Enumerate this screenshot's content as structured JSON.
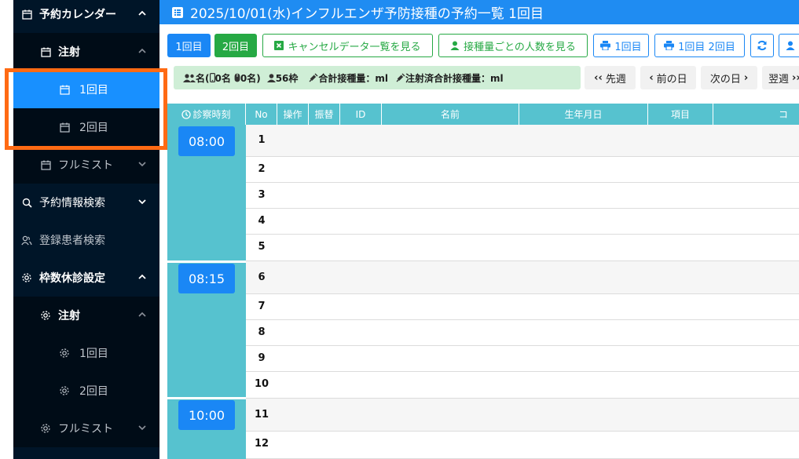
{
  "sidebar": {
    "items": [
      {
        "label": "予約カレンダー",
        "icon": "calendar-icon"
      },
      {
        "label": "注射",
        "icon": "calendar-icon"
      },
      {
        "label": "1回目",
        "icon": "calendar-icon"
      },
      {
        "label": "2回目",
        "icon": "calendar-icon"
      },
      {
        "label": "フルミスト",
        "icon": "calendar-icon"
      },
      {
        "label": "予約情報検索",
        "icon": "search-icon"
      },
      {
        "label": "登録患者検索",
        "icon": "users-icon"
      },
      {
        "label": "枠数休診設定",
        "icon": "gear-icon"
      },
      {
        "label": "注射",
        "icon": "gear-icon"
      },
      {
        "label": "1回目",
        "icon": "gear-icon"
      },
      {
        "label": "2回目",
        "icon": "gear-icon"
      },
      {
        "label": "フルミスト",
        "icon": "gear-icon"
      }
    ]
  },
  "header": {
    "title": "2025/10/01(水)インフルエンザ予防接種の予約一覧 1回目"
  },
  "toolbar": {
    "first": "1回目",
    "second": "2回目",
    "cancel_list": "キャンセルデータ一覧を見る",
    "count_by_dose": "接種量ごとの人数を見る",
    "print_first": "1回目",
    "print_both": "1回目 2回目"
  },
  "stats": {
    "people": "名(",
    "male": "0名",
    "female": "0名)",
    "slots": "56枠",
    "total_dose": "合計接種量：ml",
    "done_dose": "注射済合計接種量：ml"
  },
  "nav": {
    "prev_week": "先週",
    "prev_day": "前の日",
    "next_day": "次の日",
    "next_week": "翌週"
  },
  "table": {
    "headers": [
      "診察時刻",
      "No",
      "操作",
      "振替",
      "ID",
      "名前",
      "生年月日",
      "項目",
      "コ"
    ],
    "times": [
      "08:00",
      "08:15",
      "10:00"
    ],
    "rows": [
      "1",
      "2",
      "3",
      "4",
      "5",
      "6",
      "7",
      "8",
      "9",
      "10",
      "11",
      "12"
    ]
  },
  "colors": {
    "accent": "#1890ff",
    "sidebar_bg": "#001528",
    "header_bg": "#1f8cf2",
    "table_header": "#56c2cf",
    "green": "#26a944",
    "highlight": "#ff6a13"
  }
}
